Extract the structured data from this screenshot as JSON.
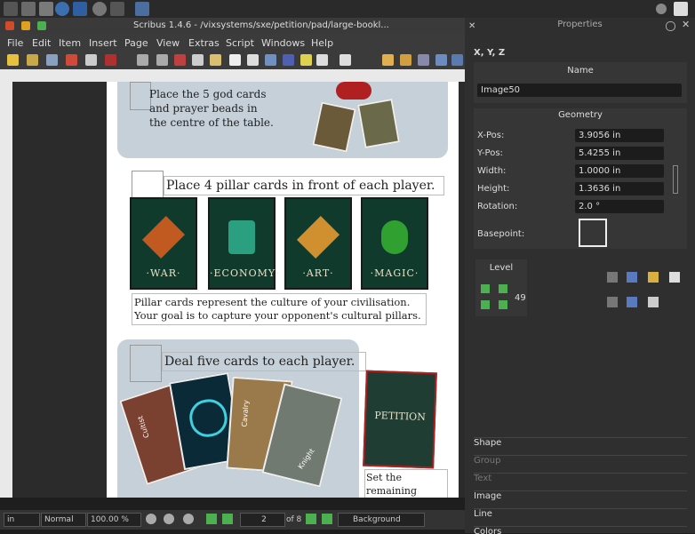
{
  "window": {
    "title": "Scribus 1.4.6 - /vixsystems/sxe/petition/pad/large-bookl..."
  },
  "menubar": [
    "File",
    "Edit",
    "Item",
    "Insert",
    "Page",
    "View",
    "Extras",
    "Script",
    "Windows",
    "Help"
  ],
  "document": {
    "panel1_text": "Place the 5 god cards and prayer beads in the centre of the table.",
    "heading_pillars": "Place 4 pillar cards in front of each player.",
    "pillar_cards": [
      "·WAR·",
      "·ECONOMY·",
      "·ART·",
      "·MAGIC·"
    ],
    "pillar_desc": "Pillar cards represent the culture of your civilisation. Your goal is to capture your opponent's cultural pillars.",
    "heading_deal": "Deal five cards to each player.",
    "petition_card": "PETITION",
    "side_text": "Set the remaining",
    "fan_card_labels": [
      "Cultist",
      "Cavalry",
      "Knight"
    ]
  },
  "statusbar": {
    "unit": "in",
    "mode": "Normal",
    "zoom": "100.00 %",
    "page": "2",
    "page_of": "of 8",
    "layer": "Background"
  },
  "properties": {
    "title": "Properties",
    "xyz_tab": "X, Y, Z",
    "name_label": "Name",
    "name_value": "Image50",
    "geometry_label": "Geometry",
    "xpos_label": "X-Pos:",
    "xpos": "3.9056 in",
    "ypos_label": "Y-Pos:",
    "ypos": "5.4255 in",
    "width_label": "Width:",
    "width": "1.0000 in",
    "height_label": "Height:",
    "height": "1.3636 in",
    "rotation_label": "Rotation:",
    "rotation": "2.0 °",
    "basepoint_label": "Basepoint:",
    "level_label": "Level",
    "level_value": "49",
    "tabs": [
      "Shape",
      "Group",
      "Text",
      "Image",
      "Line",
      "Colors"
    ]
  }
}
